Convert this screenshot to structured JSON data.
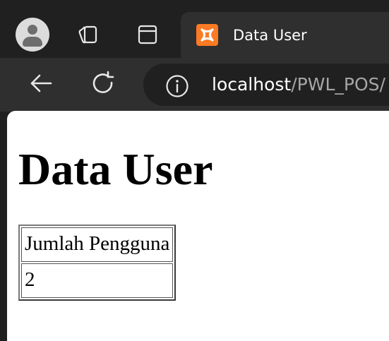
{
  "browser": {
    "tab": {
      "title": "Data User"
    },
    "address": {
      "host": "localhost",
      "path": "/PWL_POS/"
    }
  },
  "page": {
    "title": "Data User",
    "table": {
      "headers": [
        "Jumlah Pengguna"
      ],
      "rows": [
        [
          "2"
        ]
      ]
    }
  },
  "colors": {
    "chrome_dark": "#202020",
    "chrome_mid": "#2f2f2f",
    "favicon": "#fb7a24",
    "page_bg": "#ffffff"
  },
  "icons": [
    "avatar",
    "workspaces-icon",
    "tab-actions-icon",
    "xampp-favicon-icon",
    "back-arrow-icon",
    "refresh-icon",
    "info-icon"
  ]
}
